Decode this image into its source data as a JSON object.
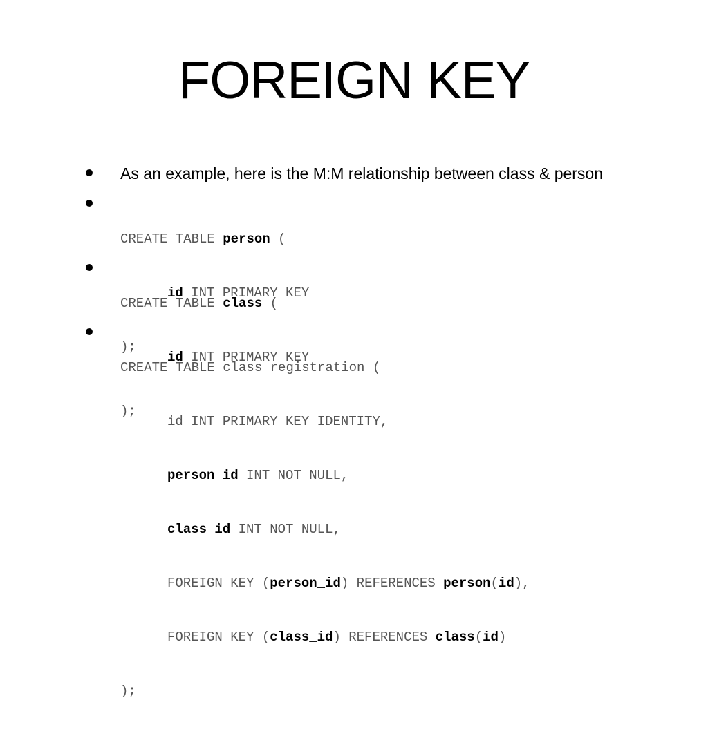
{
  "slide": {
    "title": "FOREIGN KEY",
    "intro": "As an example, here is the M:M relationship between class & person",
    "person_table": {
      "l1_kw": "CREATE TABLE ",
      "l1_name": "person",
      "l1_paren": " (",
      "l2_col": "id",
      "l2_rest": " INT PRIMARY KEY",
      "l3": ");"
    },
    "class_table": {
      "l1_kw": "CREATE TABLE ",
      "l1_name": "class",
      "l1_paren": " (",
      "l2_col": "id",
      "l2_rest": " INT PRIMARY KEY",
      "l3": ");"
    },
    "registration_table": {
      "l1": "CREATE TABLE class_registration (",
      "l2": "id INT PRIMARY KEY IDENTITY,",
      "l3_col": "person_id",
      "l3_rest": " INT NOT NULL,",
      "l4_col": "class_id",
      "l4_rest": " INT NOT NULL,",
      "l5_a": "FOREIGN KEY (",
      "l5_col": "person_id",
      "l5_b": ") REFERENCES ",
      "l5_ref": "person",
      "l5_c": "(",
      "l5_refcol": "id",
      "l5_d": "),",
      "l6_a": "FOREIGN KEY (",
      "l6_col": "class_id",
      "l6_b": ") REFERENCES ",
      "l6_ref": "class",
      "l6_c": "(",
      "l6_refcol": "id",
      "l6_d": ")",
      "l7": ");"
    }
  }
}
